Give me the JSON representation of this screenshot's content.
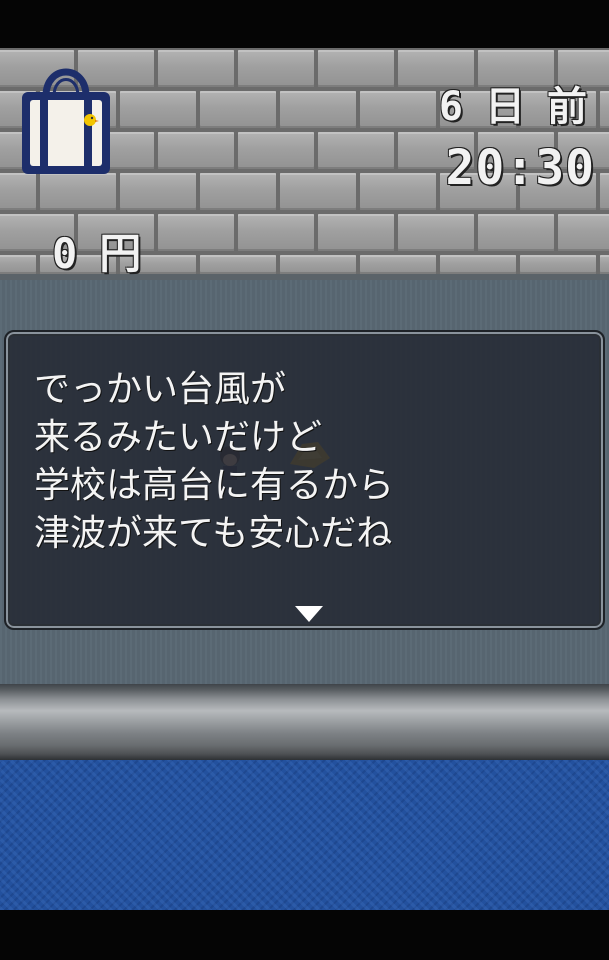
{
  "hud": {
    "money_value": "0",
    "money_unit": "円",
    "days_number": "6",
    "days_word_1": "日",
    "days_word_2": "前",
    "clock": "20:30",
    "bag_icon": "tote-bag-icon"
  },
  "dialogue": {
    "lines": [
      "でっかい台風が",
      "来るみたいだけど",
      "学校は高台に有るから",
      "津波が来ても安心だね"
    ],
    "advance_icon": "triangle-down-icon"
  },
  "colors": {
    "hud_text": "#f2f2f2",
    "window_bg": "#262a34",
    "water": "#23519e",
    "floor": "#5c6b76",
    "brick": "#a8a8a8"
  }
}
